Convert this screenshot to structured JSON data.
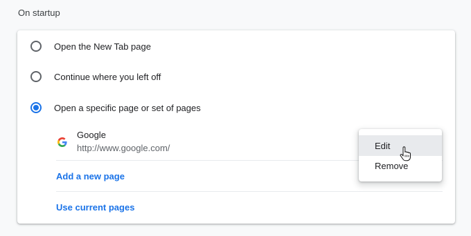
{
  "section": {
    "title": "On startup"
  },
  "options": [
    {
      "label": "Open the New Tab page",
      "checked": false
    },
    {
      "label": "Continue where you left off",
      "checked": false
    },
    {
      "label": "Open a specific page or set of pages",
      "checked": true
    }
  ],
  "pages": [
    {
      "title": "Google",
      "url": "http://www.google.com/",
      "icon": "google-favicon-icon"
    }
  ],
  "links": {
    "add_page": "Add a new page",
    "use_current": "Use current pages"
  },
  "menu": {
    "items": [
      {
        "label": "Edit",
        "hovered": true
      },
      {
        "label": "Remove",
        "hovered": false
      }
    ]
  },
  "colors": {
    "accent": "#1a73e8",
    "background": "#f8f9fa",
    "card": "#ffffff"
  }
}
